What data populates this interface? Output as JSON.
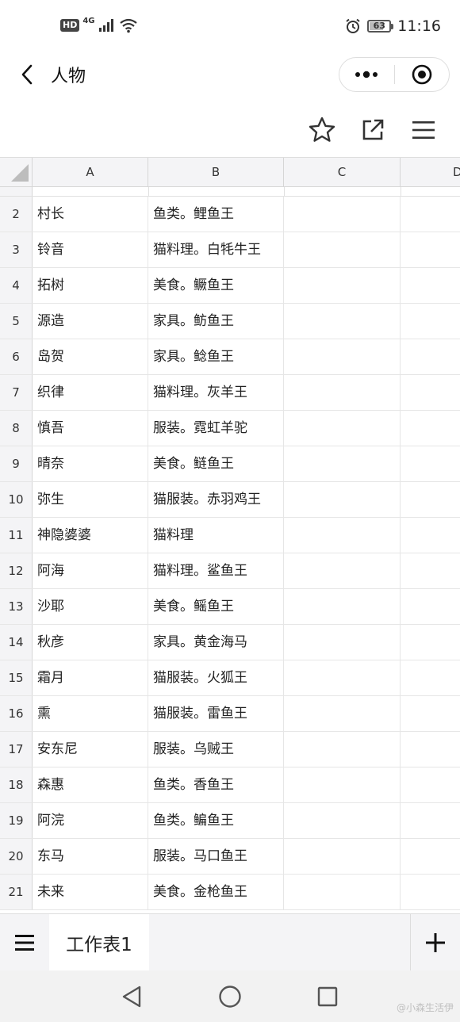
{
  "status_bar": {
    "hd": "HD",
    "network": "4G",
    "battery": "63",
    "time": "11:16"
  },
  "title_bar": {
    "title": "人物",
    "back_icon": "chevron-left-icon",
    "more_icon": "more-dots-icon",
    "close_icon": "target-circle-icon"
  },
  "toolbar": {
    "icons": [
      "star-icon",
      "share-external-icon",
      "menu-icon"
    ]
  },
  "sheet": {
    "columns": [
      "A",
      "B",
      "C",
      "D"
    ],
    "rows": [
      {
        "num": "2",
        "a": "村长",
        "b": "鱼类。鲤鱼王"
      },
      {
        "num": "3",
        "a": "铃音",
        "b": "猫料理。白牦牛王"
      },
      {
        "num": "4",
        "a": "拓树",
        "b": "美食。鳜鱼王"
      },
      {
        "num": "5",
        "a": "源造",
        "b": "家具。鲂鱼王"
      },
      {
        "num": "6",
        "a": "岛贺",
        "b": "家具。鲶鱼王"
      },
      {
        "num": "7",
        "a": "织律",
        "b": "猫料理。灰羊王"
      },
      {
        "num": "8",
        "a": "慎吾",
        "b": "服装。霓虹羊驼"
      },
      {
        "num": "9",
        "a": "晴奈",
        "b": "美食。鲢鱼王"
      },
      {
        "num": "10",
        "a": "弥生",
        "b": "猫服装。赤羽鸡王"
      },
      {
        "num": "11",
        "a": "神隐婆婆",
        "b": "猫料理"
      },
      {
        "num": "12",
        "a": "阿海",
        "b": "猫料理。鲨鱼王"
      },
      {
        "num": "13",
        "a": "沙耶",
        "b": "美食。鳐鱼王"
      },
      {
        "num": "14",
        "a": "秋彦",
        "b": "家具。黄金海马"
      },
      {
        "num": "15",
        "a": "霜月",
        "b": "猫服装。火狐王"
      },
      {
        "num": "16",
        "a": "熏",
        "b": "猫服装。雷鱼王"
      },
      {
        "num": "17",
        "a": "安东尼",
        "b": "服装。乌贼王"
      },
      {
        "num": "18",
        "a": "森惠",
        "b": "鱼类。香鱼王"
      },
      {
        "num": "19",
        "a": "阿浣",
        "b": "鱼类。鳊鱼王"
      },
      {
        "num": "20",
        "a": "东马",
        "b": "服装。马口鱼王"
      },
      {
        "num": "21",
        "a": "未来",
        "b": "美食。金枪鱼王"
      }
    ]
  },
  "tabs": {
    "active_sheet": "工作表1",
    "menu_icon": "menu-icon",
    "add_icon": "plus-icon"
  },
  "nav": {
    "icons": [
      "back-triangle-icon",
      "home-circle-icon",
      "recents-square-icon"
    ],
    "watermark": "@小森生活伊"
  }
}
